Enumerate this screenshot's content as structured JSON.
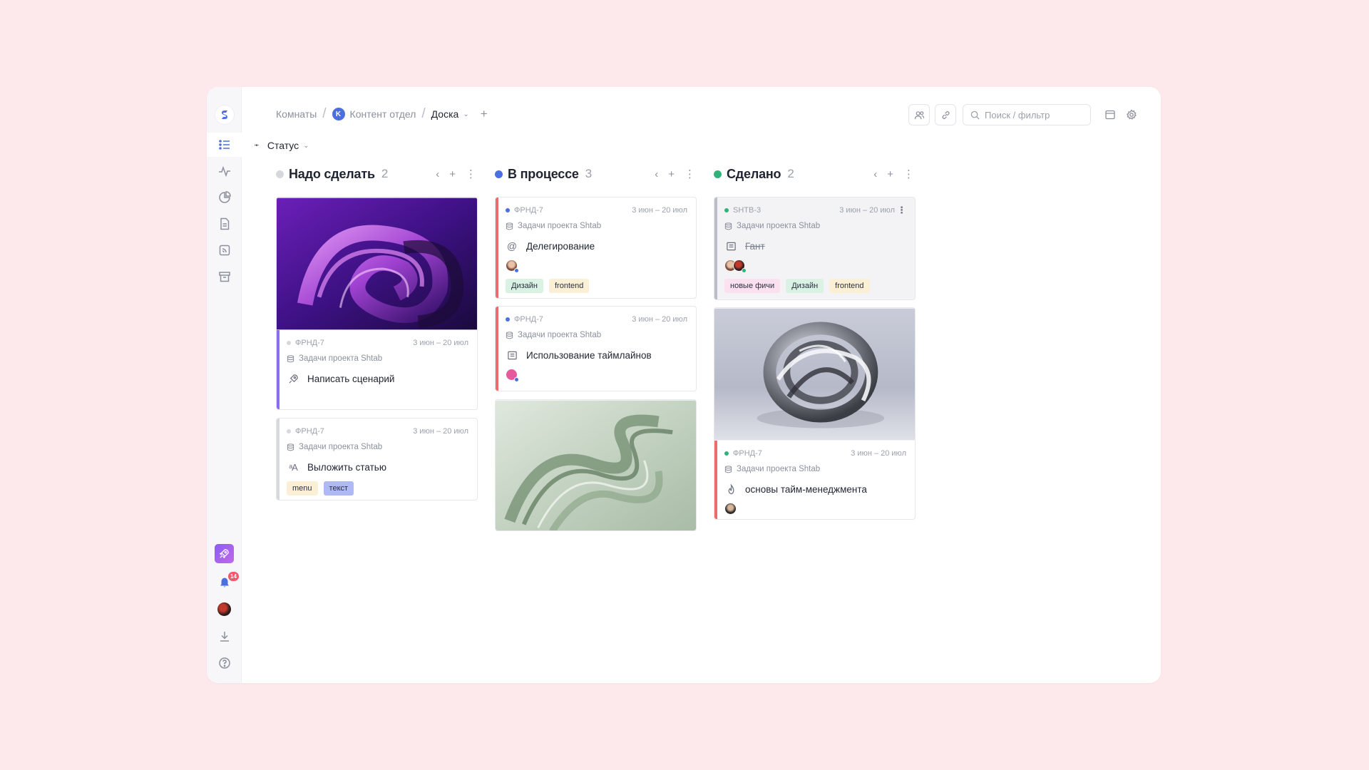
{
  "breadcrumb": {
    "rooms": "Комнаты",
    "team_initial": "K",
    "team": "Контент отдел",
    "current": "Доска"
  },
  "search": {
    "placeholder": "Поиск / фильтр"
  },
  "grouping": {
    "label": "Статус"
  },
  "notifications": {
    "count": "14"
  },
  "colors": {
    "accent": "#4b6fe0",
    "todo": "#d6d8de",
    "progress": "#4b6fe0",
    "done": "#2fb37a"
  },
  "columns": [
    {
      "title": "Надо сделать",
      "count": "2",
      "cards": [
        {
          "key": "ФРНД-7",
          "date": "3 июн – 20 июл",
          "project": "Задачи проекта Shtab",
          "title": "Написать сценарий",
          "icon": "rocket-icon",
          "tags": []
        },
        {
          "key": "ФРНД-7",
          "date": "3 июн – 20 июл",
          "project": "Задачи проекта Shtab",
          "title": "Выложить статью",
          "icon": "text-size-icon",
          "tags": [
            "menu",
            "текст"
          ]
        }
      ]
    },
    {
      "title": "В процессе",
      "count": "3",
      "cards": [
        {
          "key": "ФРНД-7",
          "date": "3 июн – 20 июл",
          "project": "Задачи проекта Shtab",
          "title": "Делегирование",
          "icon": "at-icon",
          "tags": [
            "Дизайн",
            "frontend"
          ]
        },
        {
          "key": "ФРНД-7",
          "date": "3 июн – 20 июл",
          "project": "Задачи проекта Shtab",
          "title": "Использование таймлайнов",
          "icon": "document-icon",
          "tags": []
        }
      ]
    },
    {
      "title": "Сделано",
      "count": "2",
      "cards": [
        {
          "key": "SHTB-3",
          "date": "3 июн – 20 июл",
          "project": "Задачи проекта Shtab",
          "title": "Гант",
          "icon": "document-icon",
          "tags": [
            "новые фичи",
            "Дизайн",
            "frontend"
          ]
        },
        {
          "key": "ФРНД-7",
          "date": "3 июн – 20 июл",
          "project": "Задачи проекта Shtab",
          "title": "основы тайм-менеджмента",
          "icon": "flame-icon",
          "tags": []
        }
      ]
    }
  ]
}
